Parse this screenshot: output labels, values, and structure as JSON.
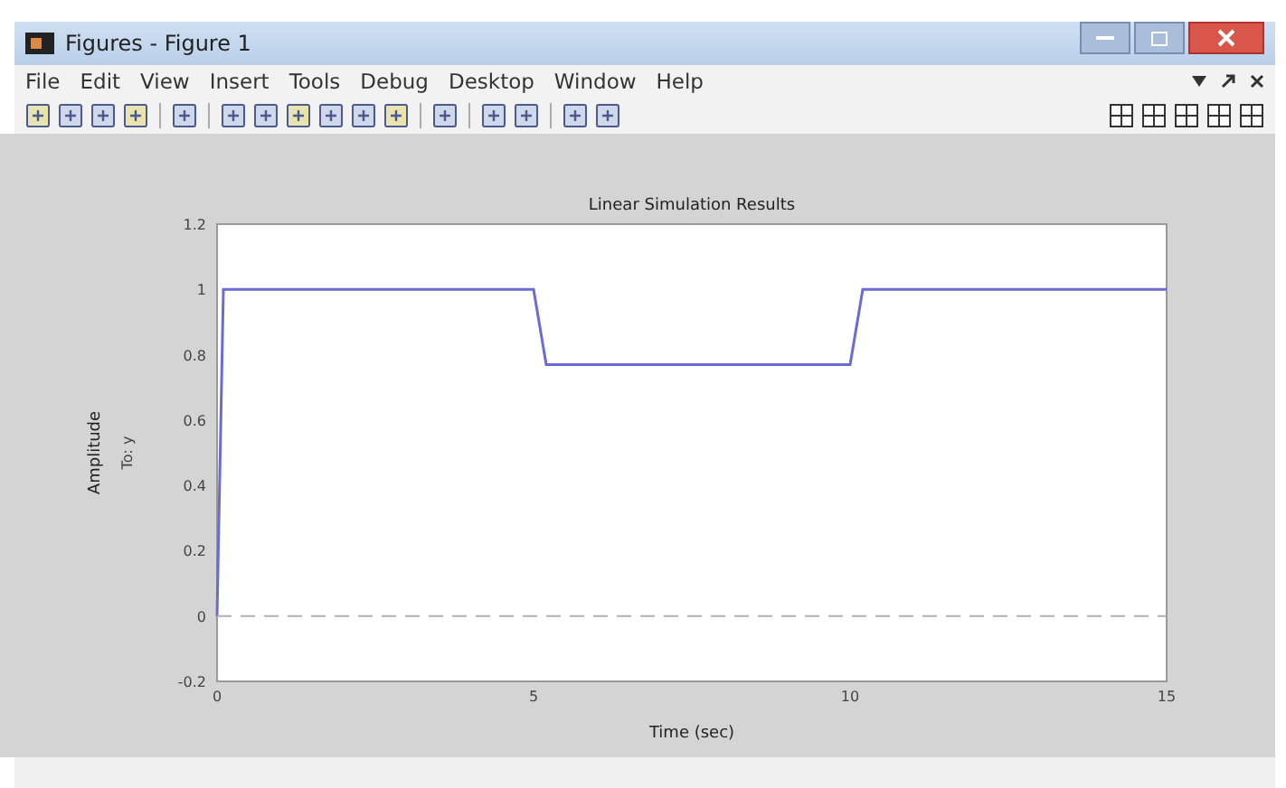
{
  "window": {
    "title": "Figures - Figure 1"
  },
  "menu": [
    "File",
    "Edit",
    "View",
    "Insert",
    "Tools",
    "Debug",
    "Desktop",
    "Window",
    "Help"
  ],
  "plot": {
    "axis_sublabel": "To: y",
    "chart_data": {
      "type": "line",
      "title": "Linear Simulation Results",
      "xlabel": "Time (sec)",
      "ylabel": "Amplitude",
      "x": [
        0,
        0.1,
        5,
        5.2,
        10,
        10.2,
        15
      ],
      "series": [
        {
          "color": "#6b6bd6",
          "line_style": "solid",
          "values": [
            0,
            1,
            1,
            0.77,
            0.77,
            1,
            1
          ]
        },
        {
          "color": "#b0b0b0",
          "line_style": "dashed",
          "values": [
            0,
            0,
            0,
            0,
            0,
            0,
            0
          ]
        }
      ],
      "xlim": [
        0,
        15
      ],
      "ylim": [
        -0.2,
        1.2
      ],
      "xticks": [
        0,
        5,
        10,
        15
      ],
      "yticks": [
        -0.2,
        0,
        0.2,
        0.4,
        0.6,
        0.8,
        1,
        1.2
      ]
    }
  }
}
